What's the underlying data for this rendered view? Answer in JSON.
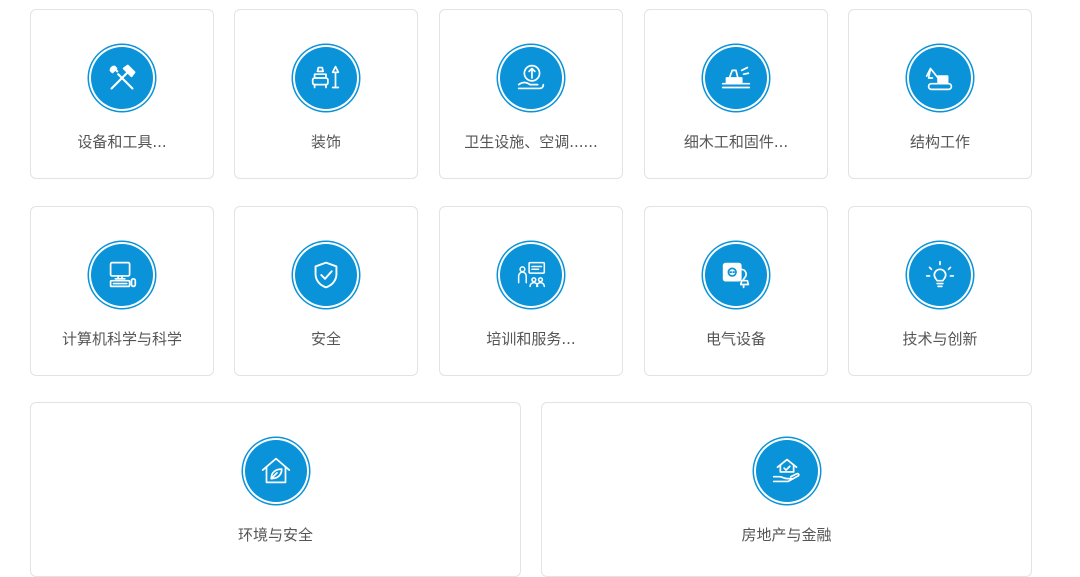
{
  "accent_color": "#0a93d8",
  "categories": [
    {
      "label": "设备和工具...",
      "icon": "tools-icon"
    },
    {
      "label": "装饰",
      "icon": "furniture-icon"
    },
    {
      "label": "卫生设施、空调......",
      "icon": "plumbing-icon"
    },
    {
      "label": "细木工和固件...",
      "icon": "carpentry-plane-icon"
    },
    {
      "label": "结构工作",
      "icon": "excavator-icon"
    },
    {
      "label": "计算机科学与科学",
      "icon": "computer-icon"
    },
    {
      "label": "安全",
      "icon": "shield-check-icon"
    },
    {
      "label": "培训和服务...",
      "icon": "training-icon"
    },
    {
      "label": "电气设备",
      "icon": "electrical-plug-icon"
    },
    {
      "label": "技术与创新",
      "icon": "lightbulb-icon"
    },
    {
      "label": "环境与安全",
      "icon": "eco-house-icon"
    },
    {
      "label": "房地产与金融",
      "icon": "house-hand-icon"
    }
  ]
}
